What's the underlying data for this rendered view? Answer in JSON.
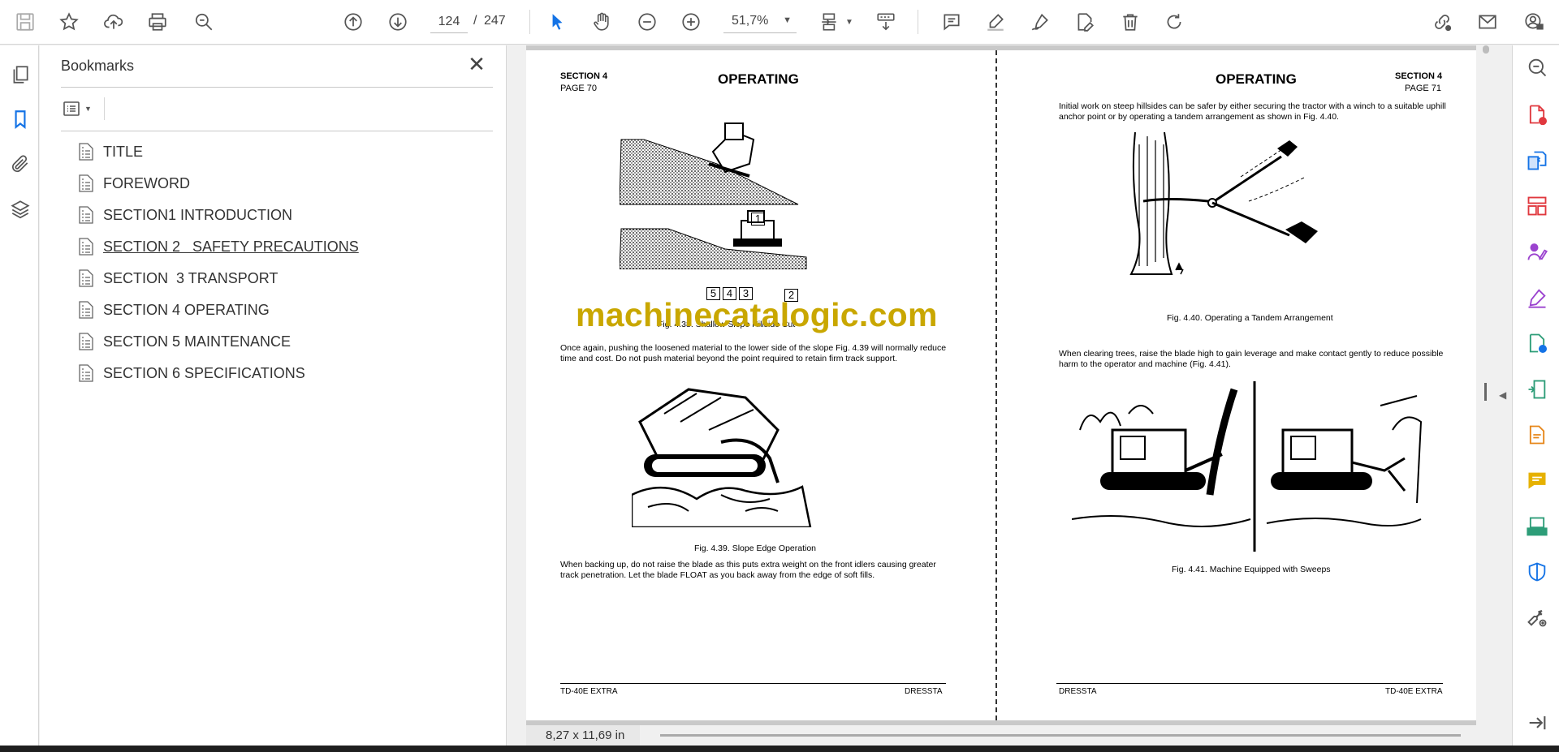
{
  "toolbar": {
    "current_page": "124",
    "page_separator": "/",
    "total_pages": "247",
    "zoom": "51,7%"
  },
  "bookmarks_panel": {
    "title": "Bookmarks",
    "items": [
      {
        "label": "TITLE"
      },
      {
        "label": "FOREWORD"
      },
      {
        "label": "SECTION1 INTRODUCTION"
      },
      {
        "label": "SECTION 2   SAFETY PRECAUTIONS"
      },
      {
        "label": "SECTION  3 TRANSPORT"
      },
      {
        "label": "SECTION 4 OPERATING"
      },
      {
        "label": "SECTION 5 MAINTENANCE"
      },
      {
        "label": "SECTION 6 SPECIFICATIONS"
      }
    ]
  },
  "document": {
    "left_page": {
      "section": "SECTION 4",
      "page": "PAGE 70",
      "heading": "OPERATING",
      "fig_438_caption": "Fig. 4.38. Shallow Slope Hillside Cut",
      "callouts": [
        "1",
        "5",
        "4",
        "3",
        "2"
      ],
      "para1_line1": "Once again, pushing the loosened material to the lower side of the slope Fig. 4.39 will normally reduce",
      "para1_line2": "time and cost. Do not push material beyond the point required to retain firm track support.",
      "fig_439_caption": "Fig. 4.39. Slope Edge Operation",
      "para2_line1": "When backing up, do not raise the blade as this puts extra weight on the front idlers causing greater",
      "para2_line2": "track penetration. Let the blade FLOAT as you back away from the edge of soft fills.",
      "footer_left": "TD-40E EXTRA",
      "footer_right": "DRESSTA"
    },
    "right_page": {
      "heading": "OPERATING",
      "section": "SECTION 4",
      "page": "PAGE 71",
      "para1_line1": "Initial work on steep hillsides can be safer by either securing the tractor with a winch to a suitable uphill",
      "para1_line2": "anchor point or by operating a tandem arrangement as shown in Fig. 4.40.",
      "fig_440_caption": "Fig. 4.40. Operating a Tandem Arrangement",
      "para2_line1": "When clearing trees, raise the blade high to gain leverage and make contact gently to reduce possible",
      "para2_line2": "harm to the operator and machine (Fig. 4.41).",
      "fig_441_caption": "Fig. 4.41. Machine Equipped with Sweeps",
      "footer_left": "DRESSTA",
      "footer_right": "TD-40E EXTRA"
    },
    "watermark": "machinecatalogic.com"
  },
  "status": {
    "page_size": "8,27 x 11,69 in"
  },
  "colors": {
    "accent_blue": "#1473e6",
    "watermark": "#c9a700",
    "rail_red": "#e0383e",
    "rail_purple": "#9b43cf",
    "rail_green": "#2d9d78",
    "rail_orange": "#e68619"
  }
}
